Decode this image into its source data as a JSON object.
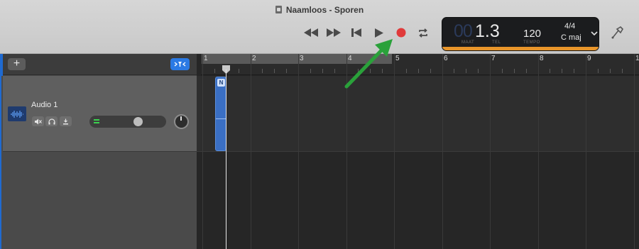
{
  "window": {
    "title": "Naamloos - Sporen"
  },
  "transport": {
    "rewind": "rewind-icon",
    "forward": "fast-forward-icon",
    "to_start": "go-to-start-icon",
    "play": "play-icon",
    "record": "record-icon",
    "cycle": "cycle-icon",
    "record_color": "#e03a3a"
  },
  "lcd": {
    "position_dim": "00",
    "position": "1.3",
    "label_bar": "MAAT",
    "label_beat": "TEL",
    "tempo": "120",
    "label_tempo": "TEMPO",
    "signature": "4/4",
    "key": "C maj",
    "accent_color": "#e8952a"
  },
  "tracks_header": {
    "add_label": "+"
  },
  "tracks": [
    {
      "name": "Audio 1",
      "volume": 0.65,
      "icon": "waveform-icon"
    }
  ],
  "ruler": {
    "bars": [
      "1",
      "2",
      "3",
      "4",
      "5",
      "6",
      "7",
      "8",
      "9",
      "1"
    ]
  },
  "region": {
    "label": "N"
  },
  "annotation": {
    "arrow_color": "#2aa13a"
  }
}
